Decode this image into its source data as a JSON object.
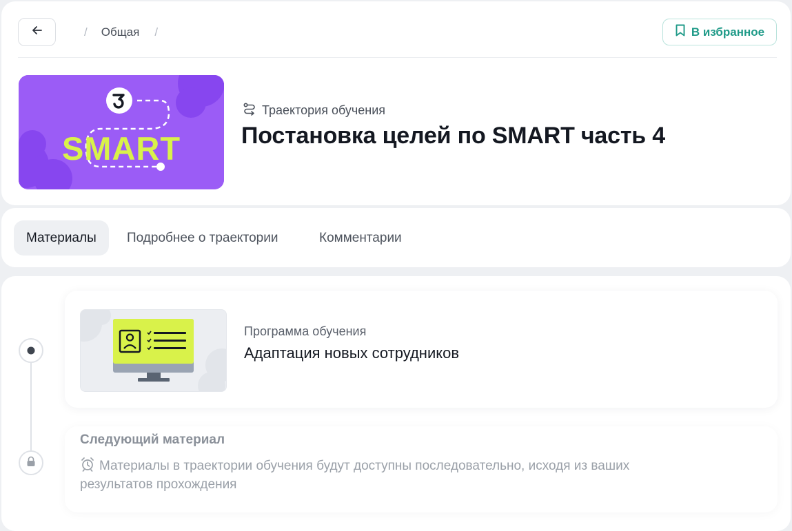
{
  "header": {
    "back_icon": "arrow-left-icon",
    "breadcrumb": {
      "separator": "/",
      "items": [
        "Общая"
      ]
    },
    "favorite": {
      "icon": "bookmark-icon",
      "label": "В избранное",
      "color": "#1f9a88"
    },
    "cover": {
      "text": "SMART",
      "bg_color": "#9a5cf5",
      "accent_color": "#d9f24a"
    },
    "kind": {
      "icon": "route-icon",
      "label": "Траектория обучения"
    },
    "title": "Постановка целей по SMART часть 4"
  },
  "tabs": [
    {
      "label": "Материалы",
      "active": true
    },
    {
      "label": "Подробнее о траектории",
      "active": false
    },
    {
      "label": "Комментарии",
      "active": false
    }
  ],
  "materials": [
    {
      "kind": "Программа обучения",
      "title": "Адаптация новых сотрудников",
      "thumb_icon": "monitor-profile-icon"
    }
  ],
  "next": {
    "title": "Следующий материал",
    "icon": "alarm-clock-icon",
    "description": "Материалы в траектории обучения будут доступны последовательно, исходя из ваших результатов прохождения"
  }
}
